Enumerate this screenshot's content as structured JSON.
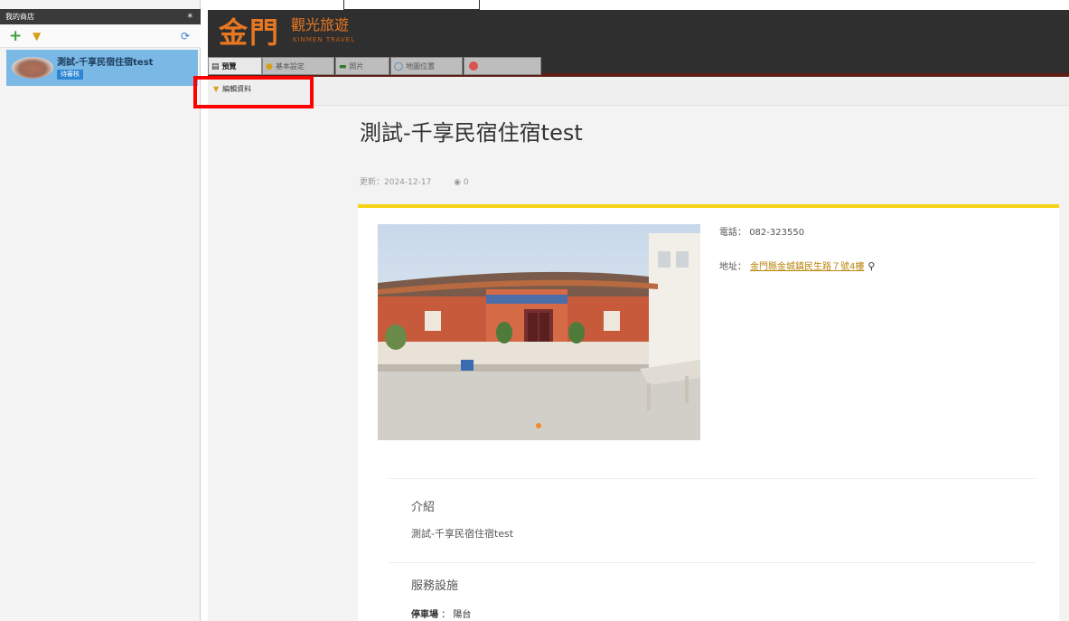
{
  "sidebar": {
    "header": "我的商店",
    "pin_icon": "pin-icon",
    "tools": {
      "add_icon": "plus-icon",
      "tip_icon": "bulb-icon",
      "refresh_icon": "refresh-icon"
    },
    "item": {
      "name": "測試-千享民宿住宿test",
      "badge": "待審核"
    }
  },
  "header": {
    "logo_main": "金門",
    "logo_text": "觀光旅遊",
    "logo_sub": "KINMEN TRAVEL"
  },
  "tabs": [
    {
      "label": "預覽",
      "icon": "preview-icon"
    },
    {
      "label": "基本設定",
      "icon": "bulb-icon"
    },
    {
      "label": "照片",
      "icon": "photo-icon"
    },
    {
      "label": "地圖位置",
      "icon": "clock-icon"
    }
  ],
  "toolbar": {
    "edit_label": "編輯資料",
    "edit_icon": "bulb-icon"
  },
  "colors": {
    "brand": "#e87722",
    "accent_line": "#f5d214",
    "highlight": "#ff0000",
    "selected_item": "#7ab8e6"
  },
  "page": {
    "title": "測試-千享民宿住宿test",
    "updated": "更新：2024-12-17",
    "views": "0",
    "phone_label": "電話：",
    "phone": "082-323550",
    "address_label": "地址：",
    "address": "金門縣金城鎮民生路７號4樓",
    "intro_heading": "介紹",
    "intro_text": "測試-千享民宿住宿test",
    "services_heading": "服務設施",
    "services": {
      "label": "停車場",
      "value": "陽台"
    }
  }
}
